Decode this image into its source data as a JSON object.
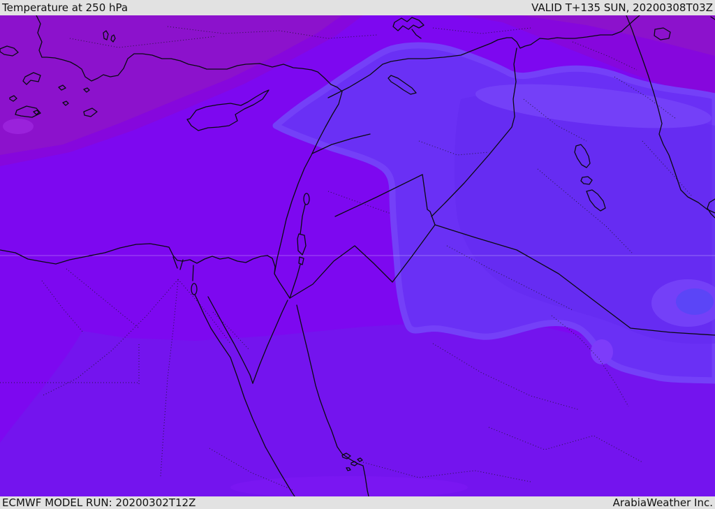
{
  "header": {
    "title": "Temperature at 250 hPa",
    "valid_label": "VALID T+135 SUN, 20200308T03Z"
  },
  "footer": {
    "model_run": "ECMWF MODEL RUN: 20200302T12Z",
    "credit": "ArabiaWeather Inc."
  },
  "map": {
    "description": "ECMWF 250 hPa temperature forecast filled-contour map over the Middle East and Eastern Mediterranean",
    "palette": {
      "band_warmest": "#8c12cc",
      "band_warm": "#8607dd",
      "band_main_violet": "#7d08f0",
      "band_south_violet": "#7414ee",
      "band_cool_blue": "#6a30f5",
      "band_cool_fringe": "#7440f8",
      "band_cool_core": "#6229ee",
      "band_coolest": "#5b45f7",
      "blob_light_violet": "#9a22db",
      "blob_bottom_light": "#7e17f5",
      "hook_light": "#7d3cfa",
      "border_line": "#0a0a12",
      "admin_line": "#15151f",
      "graticule": "rgba(255,255,255,0.30)",
      "bar_bg": "#e2e2e2",
      "bar_text": "#111111"
    }
  }
}
